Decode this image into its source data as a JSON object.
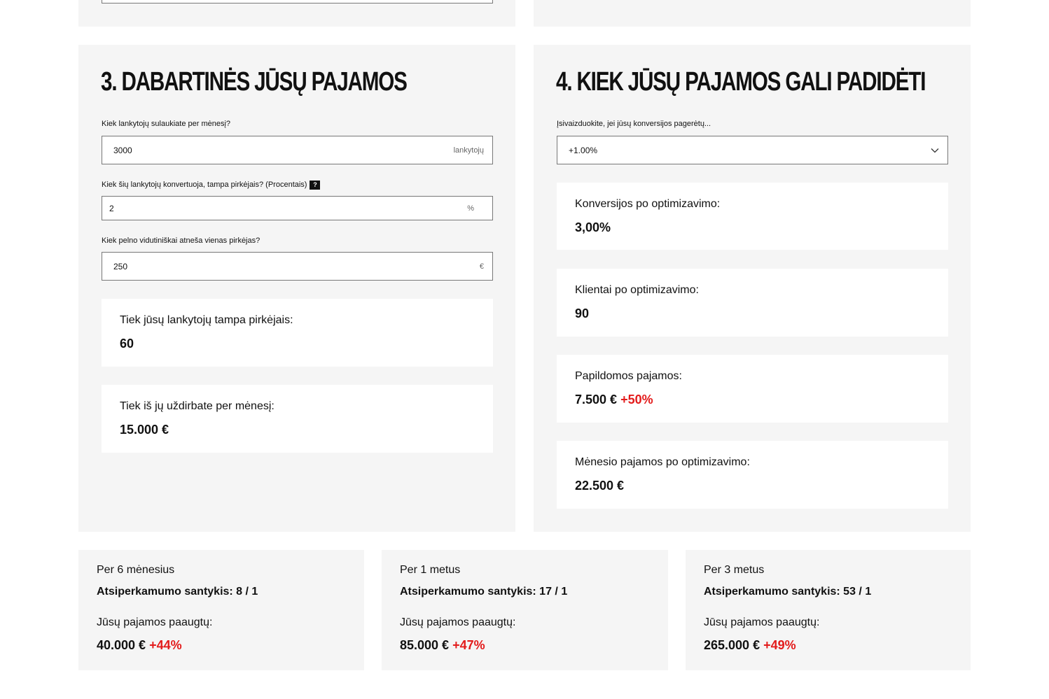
{
  "section3": {
    "title": "3. DABARTINĖS JŪSŲ PAJAMOS",
    "visitors_label": "Kiek lankytojų sulaukiate per mėnesį?",
    "visitors_value": "3000",
    "visitors_unit": "lankytojų",
    "conversion_label": "Kiek šių lankytojų konvertuoja, tampa pirkėjais? (Procentais)",
    "help_icon_text": "?",
    "conversion_value": "2",
    "conversion_unit": "%",
    "profit_label": "Kiek pelno vidutiniškai atneša vienas pirkėjas?",
    "profit_value": "250",
    "profit_unit": "€",
    "buyers_card": {
      "title": "Tiek jūsų lankytojų tampa pirkėjais:",
      "value": "60"
    },
    "earnings_card": {
      "title": "Tiek iš jų uždirbate per mėnesį:",
      "value": "15.000 €"
    }
  },
  "section4": {
    "title": "4. KIEK JŪSŲ PAJAMOS GALI PADIDĖTI",
    "improve_label": "Įsivaizduokite, jei jūsų konversijos pagerėtų...",
    "improve_selected": "+1.00%",
    "cards": [
      {
        "title": "Konversijos po optimizavimo:",
        "value": "3,00%",
        "delta": ""
      },
      {
        "title": "Klientai po optimizavimo:",
        "value": "90",
        "delta": ""
      },
      {
        "title": "Papildomos pajamos:",
        "value": "7.500 €",
        "delta": "+50%"
      },
      {
        "title": "Mėnesio pajamos po optimizavimo:",
        "value": "22.500 €",
        "delta": ""
      }
    ]
  },
  "summary": [
    {
      "period": "Per 6 mėnesius",
      "ratio": "Atsiperkamumo santykis: 8 / 1",
      "growth_label": "Jūsų pajamos paaugtų:",
      "growth_value": "40.000 €",
      "growth_pct": "+44%"
    },
    {
      "period": "Per 1 metus",
      "ratio": "Atsiperkamumo santykis: 17 / 1",
      "growth_label": "Jūsų pajamos paaugtų:",
      "growth_value": "85.000 €",
      "growth_pct": "+47%"
    },
    {
      "period": "Per 3 metus",
      "ratio": "Atsiperkamumo santykis: 53 / 1",
      "growth_label": "Jūsų pajamos paaugtų:",
      "growth_value": "265.000 €",
      "growth_pct": "+49%"
    }
  ],
  "colors": {
    "accent_red": "#e31b1b",
    "panel_bg": "#f5f5f5"
  }
}
